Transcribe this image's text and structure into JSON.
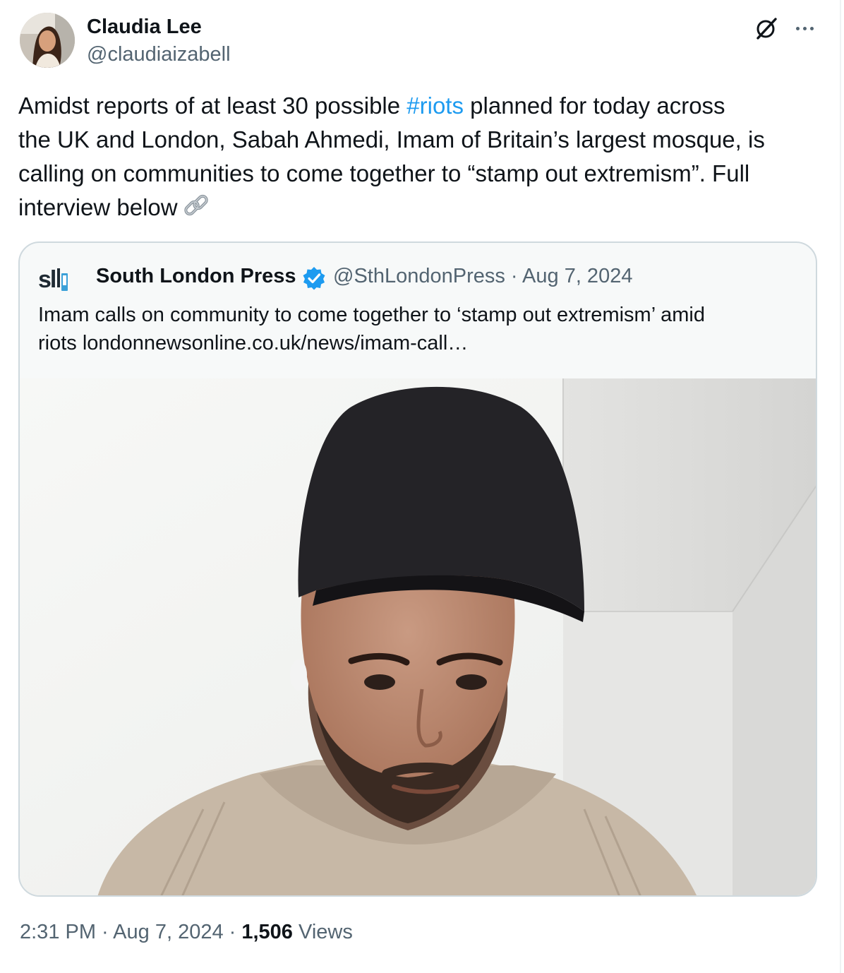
{
  "author": {
    "name": "Claudia Lee",
    "handle": "@claudiaizabell"
  },
  "header_actions": {
    "grok_icon": "grok-slash-icon",
    "more_icon": "more-horizontal-icon"
  },
  "tweet": {
    "lines": [
      {
        "before": "Amidst reports of at least 30 possible ",
        "hashtag": "#riots",
        "after": " planned for today across"
      },
      {
        "text": "the UK and London,  Sabah Ahmedi, Imam of Britain’s largest mosque, is"
      },
      {
        "text": "calling on communities to come together to “stamp out extremism”. Full"
      },
      {
        "text": "interview below"
      }
    ],
    "emoji": "link-emoji"
  },
  "quote": {
    "name": "South London Press",
    "logo_text": "slp",
    "handle": "@SthLondonPress",
    "separator": "·",
    "date": "Aug 7, 2024",
    "meta": "@SthLondonPress · Aug 7, 2024",
    "text_lines": [
      "Imam calls on community to come together to ‘stamp out extremism’ amid",
      "riots londonnewsonline.co.uk/news/imam-call…"
    ]
  },
  "footer": {
    "timestamp": "2:31 PM · Aug 7, 2024 · ",
    "views_count": "1,506",
    "views_label": " Views"
  },
  "colors": {
    "link": "#1d9bf0",
    "text": "#0f1419",
    "secondary": "#536471",
    "border": "#cfd9de",
    "verified": "#1d9bf0"
  }
}
